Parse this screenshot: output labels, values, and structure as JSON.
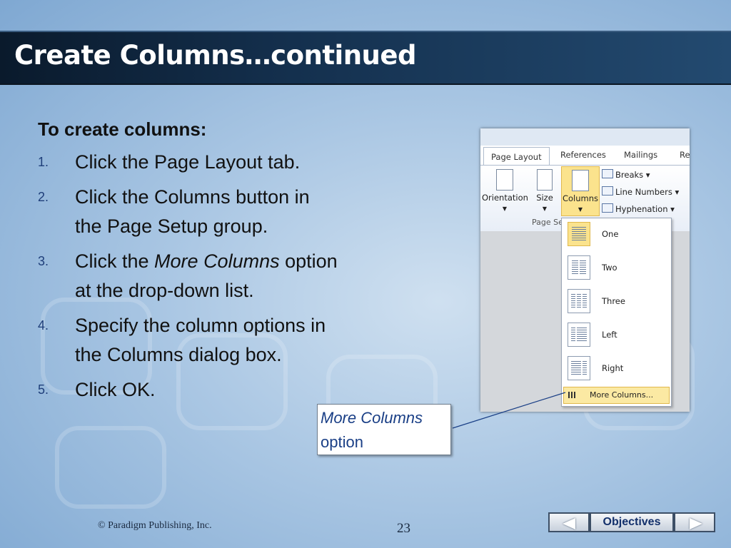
{
  "slide": {
    "title": "Create Columns…continued",
    "heading": "To create columns:",
    "steps": [
      {
        "num": "1.",
        "text": "Click the Page Layout tab."
      },
      {
        "num": "2.",
        "text": "Click the Columns button in the Page Setup group."
      },
      {
        "num": "3.",
        "pre": "Click the ",
        "ital": "More Columns",
        "post": " option at the drop-down list."
      },
      {
        "num": "4.",
        "text": "Specify the column options in the Columns dialog box."
      },
      {
        "num": "5.",
        "text": "Click OK."
      }
    ],
    "callout": {
      "line1": "More Columns",
      "line2": "option"
    },
    "footer": {
      "copyright": "© Paradigm Publishing, Inc.",
      "page": "23"
    },
    "nav": {
      "objectives": "Objectives"
    }
  },
  "screenshot": {
    "tabs": [
      "Page Layout",
      "References",
      "Mailings",
      "Re"
    ],
    "ribbon_buttons": [
      "Orientation",
      "Size",
      "Columns"
    ],
    "small_buttons": [
      "Breaks",
      "Line Numbers",
      "Hyphenation"
    ],
    "group_label": "Page Se",
    "menu_items": [
      "One",
      "Two",
      "Three",
      "Left",
      "Right"
    ],
    "more_columns": "More Columns..."
  },
  "colors": {
    "title_bar": "#14304e",
    "highlight": "#fbe38d",
    "callout_text": "#1a3f86"
  }
}
